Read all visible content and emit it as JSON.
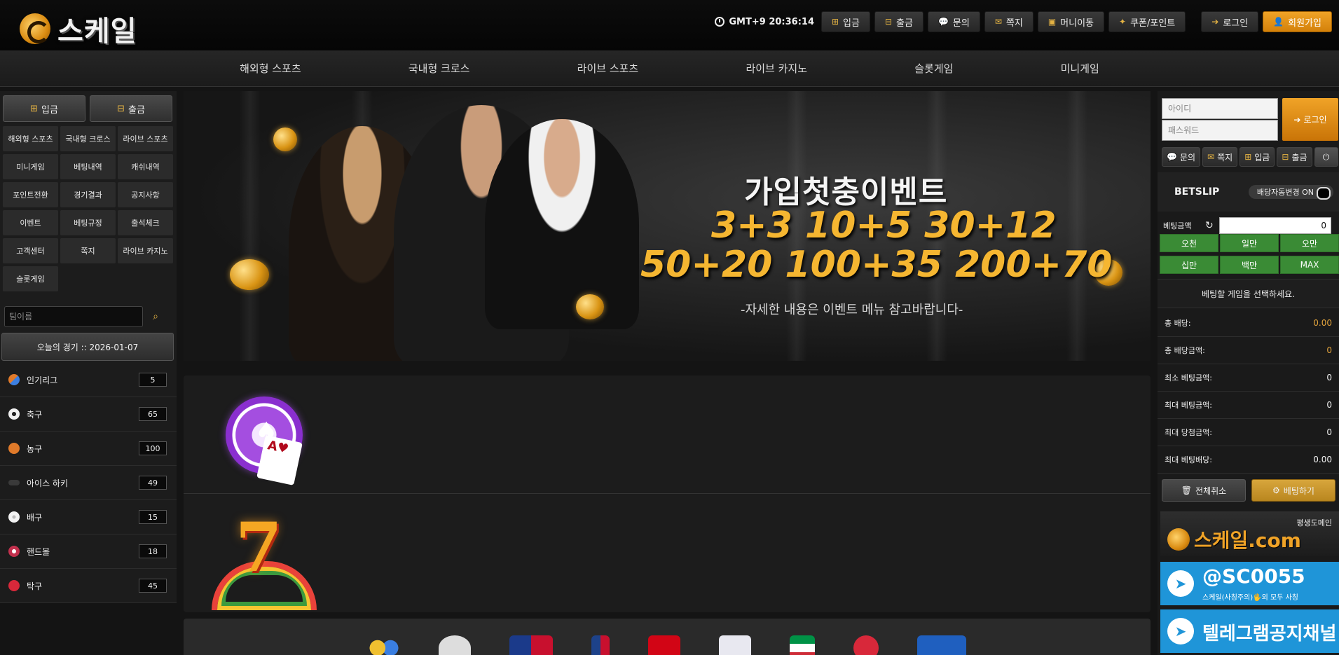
{
  "brand": {
    "name": "스케일"
  },
  "header": {
    "clock": "GMT+9 20:36:14",
    "buttons": [
      {
        "label": "입금",
        "icon": "plus-square-icon"
      },
      {
        "label": "출금",
        "icon": "minus-square-icon"
      },
      {
        "label": "문의",
        "icon": "chat-icon"
      },
      {
        "label": "쪽지",
        "icon": "envelope-icon"
      },
      {
        "label": "머니이동",
        "icon": "money-icon"
      },
      {
        "label": "쿠폰/포인트",
        "icon": "ticket-icon"
      }
    ],
    "login_label": "로그인",
    "join_label": "회원가입"
  },
  "nav": [
    "해외형 스포츠",
    "국내형 크로스",
    "라이브 스포츠",
    "라이브 카지노",
    "슬롯게임",
    "미니게임"
  ],
  "left": {
    "deposit_label": "입금",
    "withdraw_label": "출금",
    "menu": [
      "해외형 스포츠",
      "국내형 크로스",
      "라이브 스포츠",
      "미니게임",
      "베팅내역",
      "캐쉬내역",
      "포인트전환",
      "경기결과",
      "공지사항",
      "이벤트",
      "베팅규정",
      "출석체크",
      "고객센터",
      "쪽지",
      "라이브 카지노",
      "슬롯게임"
    ],
    "search_placeholder": "팀이름",
    "today_label": "오늘의 경기 ::  2026-01-07",
    "leagues": [
      {
        "name": "인기리그",
        "count": "5",
        "color": "#3d7fe0"
      },
      {
        "name": "축구",
        "count": "65",
        "color": "#f0f0f0"
      },
      {
        "name": "농구",
        "count": "100",
        "color": "#e07a2a"
      },
      {
        "name": "아이스 하키",
        "count": "49",
        "color": "#444444"
      },
      {
        "name": "배구",
        "count": "15",
        "color": "#dddddd"
      },
      {
        "name": "핸드볼",
        "count": "18",
        "color": "#c2304d"
      },
      {
        "name": "탁구",
        "count": "45",
        "color": "#d8283a"
      }
    ]
  },
  "banner": {
    "title": "가입첫충이벤트",
    "line1": "3+3 10+5 30+12",
    "line2": "50+20 100+35 200+70",
    "sub": "-자세한 내용은 이벤트 메뉴 참고바랍니다-"
  },
  "right": {
    "id_placeholder": "아이디",
    "pw_placeholder": "패스워드",
    "login_label": "로그인",
    "quick": [
      "문의",
      "쪽지",
      "입금",
      "출금"
    ],
    "betslip_title": "BETSLIP",
    "toggle_label": "배당자동변경 ON",
    "bet_amount_label": "베팅금액",
    "bet_amount_value": "0",
    "amounts": [
      "오천",
      "일만",
      "오만",
      "십만",
      "백만",
      "MAX"
    ],
    "select_msg": "베팅할 게임을 선택하세요.",
    "stats": [
      {
        "label": "총 배당:",
        "value": "0.00",
        "gold": true
      },
      {
        "label": "총 배당금액:",
        "value": "0",
        "gold": true
      },
      {
        "label": "최소 베팅금액:",
        "value": "0",
        "gold": false
      },
      {
        "label": "최대 베팅금액:",
        "value": "0",
        "gold": false
      },
      {
        "label": "최대 당첨금액:",
        "value": "0",
        "gold": false
      },
      {
        "label": "최대 베팅배당:",
        "value": "0.00",
        "gold": false
      }
    ],
    "cancel_all_label": "전체취소",
    "bet_label": "베팅하기",
    "promo_domain_small": "평생도메인",
    "promo_domain_main": "스케일.com",
    "promo_tg1_main": "@SC0055",
    "promo_tg1_sub": "스케일(사칭주의)🖐외 모두 사칭",
    "promo_tg2_main": "텔레그램공지채널"
  },
  "colors": {
    "accent": "#f0a327",
    "green": "#3a8b35",
    "telegram": "#1f95d8"
  }
}
